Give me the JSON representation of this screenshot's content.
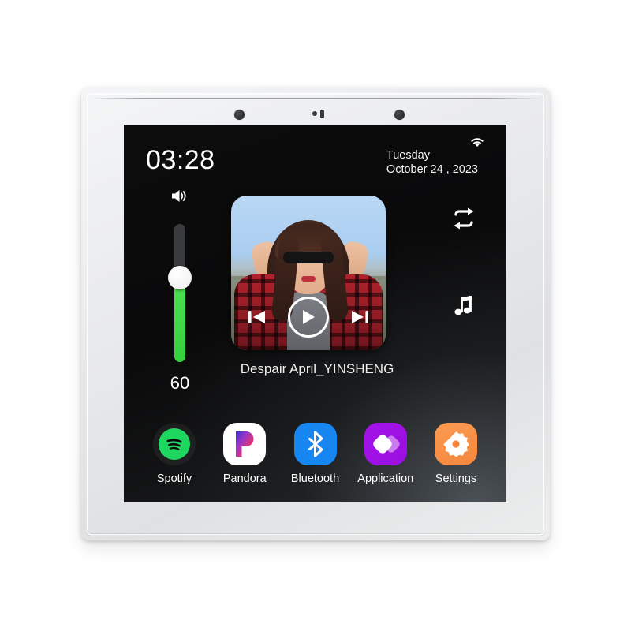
{
  "device": {
    "name": "wall-mount-music-panel",
    "sensors": [
      "sensor-left",
      "mic",
      "sensor-right"
    ]
  },
  "status_bar": {
    "clock": "03:28",
    "weekday": "Tuesday",
    "date": "October 24 , 2023",
    "wifi_icon": "wifi-icon"
  },
  "volume": {
    "icon": "speaker-volume-icon",
    "value": "60",
    "level_percent": 60,
    "fill_color": "#3fd945",
    "track_color": "#3a3b3d"
  },
  "player": {
    "album_art_alt": "woman in red plaid shirt with sunglasses making peace signs",
    "track_title": "Despair April_YINSHENG",
    "controls": {
      "previous": "previous-track-icon",
      "play": "play-icon",
      "next": "next-track-icon"
    }
  },
  "rail": {
    "repeat_icon": "repeat-icon",
    "music_note_icon": "music-note-icon"
  },
  "dock": {
    "apps": [
      {
        "label": "Spotify",
        "icon": "spotify-icon",
        "color": "#1ed760"
      },
      {
        "label": "Pandora",
        "icon": "pandora-icon",
        "color": "#ffffff"
      },
      {
        "label": "Bluetooth",
        "icon": "bluetooth-icon",
        "color": "#1786f0"
      },
      {
        "label": "Application",
        "icon": "application-icon",
        "color": "#a413e8"
      },
      {
        "label": "Settings",
        "icon": "settings-gear-icon",
        "color": "#f4873c"
      }
    ]
  }
}
